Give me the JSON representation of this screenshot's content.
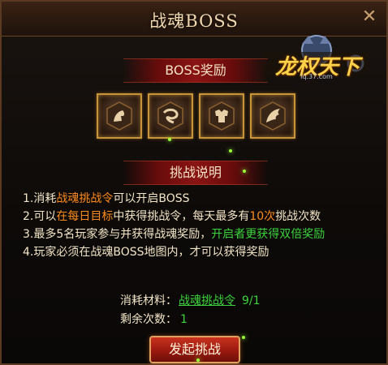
{
  "window": {
    "title": "战魂BOSS"
  },
  "logo": {
    "text": "龙权天下",
    "sub": "lq.37.com"
  },
  "reward_section": {
    "label": "BOSS奖励",
    "items": [
      "item-1",
      "item-2",
      "item-3",
      "item-4"
    ]
  },
  "rules_section": {
    "label": "挑战说明"
  },
  "rules": {
    "r1a": "1.消耗",
    "r1b": "战魂挑战令",
    "r1c": "可以开启BOSS",
    "r2a": "2.可以",
    "r2b": "在每日目标",
    "r2c": "中获得挑战令，每天最多有",
    "r2d": "10次",
    "r2e": "挑战次数",
    "r3a": "3.最多5名玩家参与并获得战魂奖励，",
    "r3b": "开启者更获得双倍奖励",
    "r4": "4.玩家必须在战魂BOSS地图内，才可以获得奖励"
  },
  "cost": {
    "label": "消耗材料：",
    "item": "战魂挑战令",
    "count": "9/1"
  },
  "remain": {
    "label": "剩余次数：",
    "value": "1"
  },
  "start_button": {
    "label": "发起挑战"
  },
  "colors": {
    "gold": "#c89438",
    "green": "#3cd43c",
    "orange": "#ff8a1e",
    "red": "#9a1a10"
  }
}
